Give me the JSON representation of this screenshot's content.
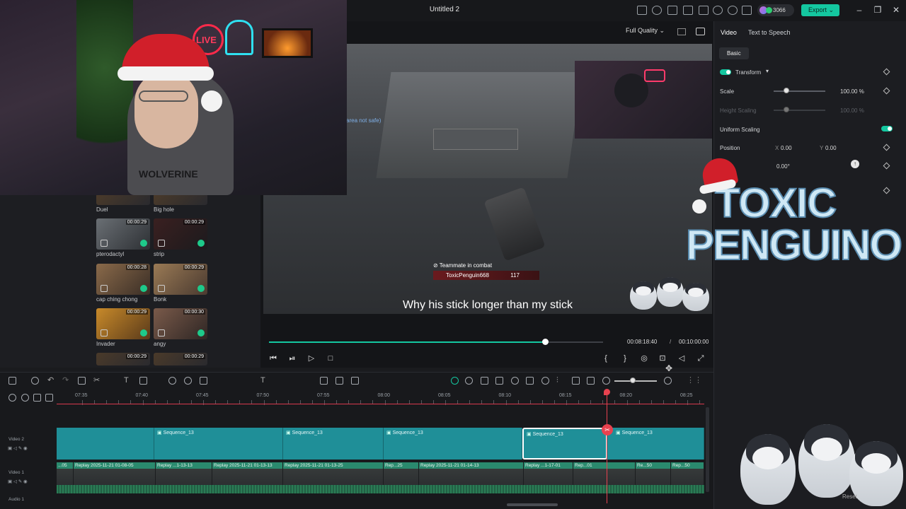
{
  "window": {
    "title": "Untitled 2",
    "credits": "3066",
    "export_label": "Export"
  },
  "preview": {
    "quality": "Full Quality",
    "caption": "Why his stick longer than my stick",
    "current_time": "00:08:18:40",
    "separator": "/",
    "total_time": "00:10:00:00",
    "progress_fraction": 0.826,
    "game_hud": {
      "status": "Teammate in combat",
      "player": "ToxicPenguin668",
      "value": "117",
      "area_text": "area not safe)"
    }
  },
  "media": {
    "clips": [
      {
        "name": "Duel"
      },
      {
        "name": "Big hole"
      },
      {
        "name": "pterodactyl",
        "duration": "00:00:29"
      },
      {
        "name": "strip",
        "duration": "00:00:29"
      },
      {
        "name": "cap ching chong",
        "duration": "00:00:28"
      },
      {
        "name": "Bonk",
        "duration": "00:00:29"
      },
      {
        "name": "Invader",
        "duration": "00:00:29"
      },
      {
        "name": "angy",
        "duration": "00:00:30"
      },
      {
        "duration": "00:00:29"
      },
      {
        "duration": "00:00:29"
      }
    ]
  },
  "webcam": {
    "sign_text": "LIVE",
    "hoodie_text": "WOLVERINE"
  },
  "properties": {
    "tabs": [
      "Video",
      "Text to Speech"
    ],
    "subtab": "Basic",
    "transform_label": "Transform",
    "scale_label": "Scale",
    "scale_value": "100.00",
    "scale_unit": "%",
    "height_scaling_label": "Height Scaling",
    "height_scaling_value": "100.00",
    "uniform_scaling_label": "Uniform Scaling",
    "position_label": "Position",
    "pos_x_label": "X",
    "pos_x": "0.00",
    "pos_y_label": "Y",
    "pos_y": "0.00",
    "rotation": "0.00°",
    "reset_label": "Reset"
  },
  "brand": {
    "line1": "TOXIC",
    "line2": "PENGUINO"
  },
  "timeline": {
    "ruler_ticks": [
      "07:35",
      "07:40",
      "07:45",
      "07:50",
      "07:55",
      "08:00",
      "08:05",
      "08:10",
      "08:15",
      "08:20",
      "08:25"
    ],
    "tracks": {
      "video2": "Video 2",
      "video1": "Video 1",
      "audio1": "Audio 1"
    },
    "sequences": [
      "Sequence_13",
      "Sequence_13",
      "Sequence_13",
      "Sequence_13",
      "Sequence_13"
    ],
    "replay_clips": [
      "...05",
      "Replay 2025-11-21 01-08-05",
      "Replay ...1-13-13",
      "Replay 2025-11-21 01-13-13",
      "Replay 2025-11-21 01-13-25",
      "Rep...25",
      "Replay 2025-11-21 01-14-13",
      "Replay ...1-17-01",
      "Rep...01",
      "Re...50",
      "Rep...50"
    ]
  },
  "colors": {
    "accent": "#14c7a0",
    "playhead": "#e8424f",
    "sequence": "#1f8f98"
  }
}
